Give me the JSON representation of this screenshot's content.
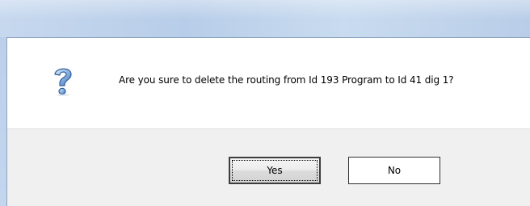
{
  "dialog": {
    "icon": "question-icon",
    "message": "Are you sure to delete the routing from Id 193 Program to Id 41 dig 1?",
    "buttons": {
      "yes": "Yes",
      "no": "No"
    },
    "default_button": "Yes"
  },
  "colors": {
    "frame": "#b9cde9",
    "content_bg": "#ffffff",
    "footer_bg": "#f0f0f0",
    "icon_blue": "#3a78c4"
  }
}
